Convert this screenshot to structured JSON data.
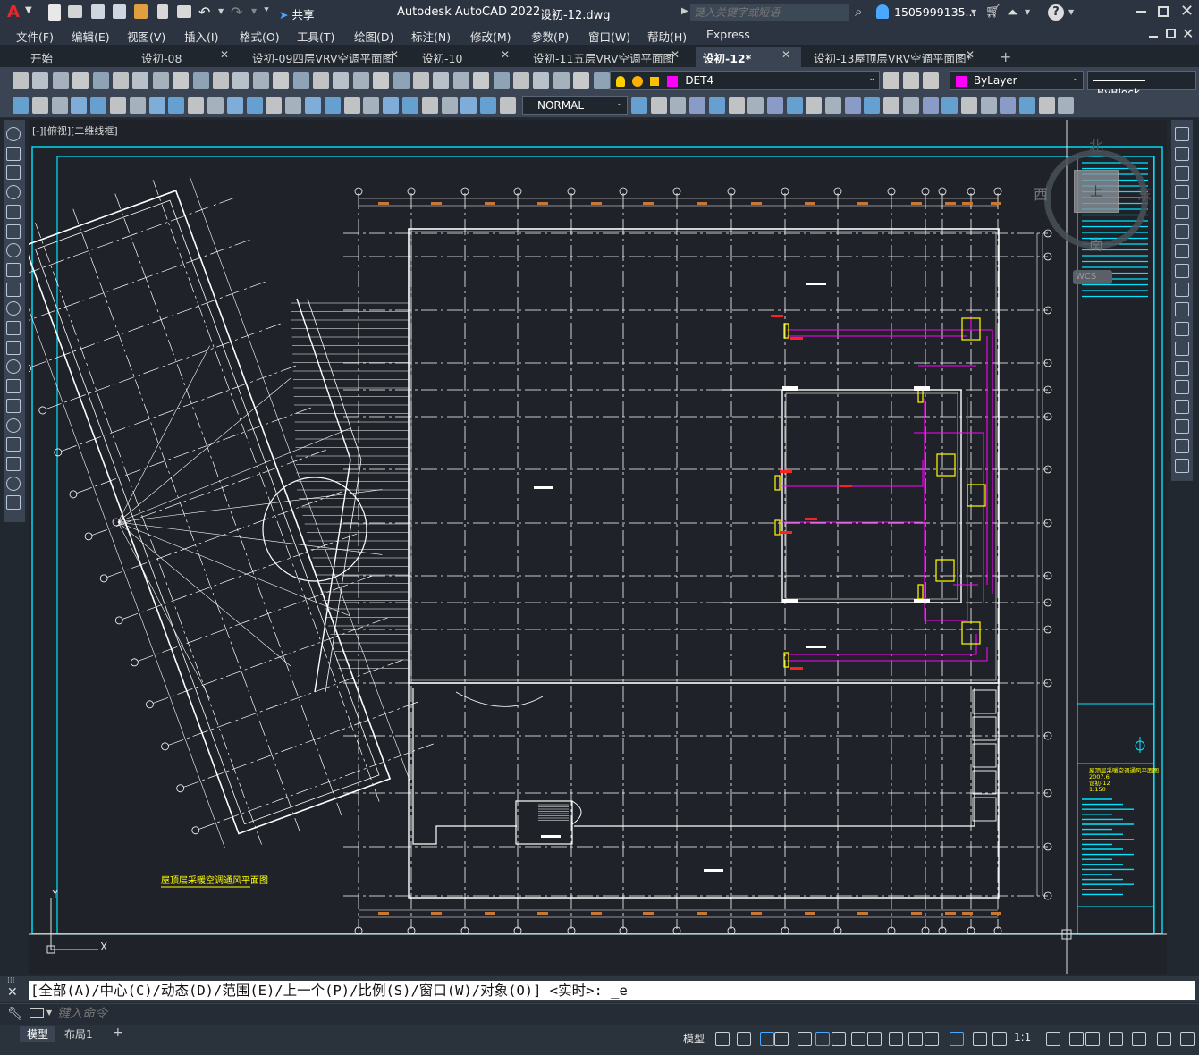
{
  "app": {
    "logo": "A",
    "title": "Autodesk AutoCAD 2022",
    "filename": "设初-12.dwg",
    "share_label": "共享",
    "search_placeholder": "键入关键字或短语",
    "user": "1505999135...",
    "help": "?"
  },
  "menu": [
    "文件(F)",
    "编辑(E)",
    "视图(V)",
    "插入(I)",
    "格式(O)",
    "工具(T)",
    "绘图(D)",
    "标注(N)",
    "修改(M)",
    "参数(P)",
    "窗口(W)",
    "帮助(H)",
    "Express"
  ],
  "tabs": [
    {
      "label": "开始",
      "active": false,
      "close": false
    },
    {
      "label": "设初-08",
      "active": false,
      "close": true
    },
    {
      "label": "设初-09四层VRV空调平面图",
      "active": false,
      "close": true
    },
    {
      "label": "设初-10",
      "active": false,
      "close": true
    },
    {
      "label": "设初-11五层VRV空调平面图",
      "active": false,
      "close": true
    },
    {
      "label": "设初-12*",
      "active": true,
      "close": true
    },
    {
      "label": "设初-13屋顶层VRV空调平面图*",
      "active": false,
      "close": true
    }
  ],
  "add_tab": "+",
  "toolbar": {
    "layer_name": "DET4",
    "color_name": "ByLayer",
    "linetype_name": "ByBlock",
    "dimstyle": "NORMAL",
    "layer_color": "#ff00ff"
  },
  "viewport": {
    "label": "[-][俯视][二维线框]",
    "drawing_title": "屋顶层采暖空调通风平面图",
    "viewcube": {
      "north": "北",
      "south": "南",
      "east": "东",
      "west": "西",
      "top": "上",
      "wcs": "WCS"
    },
    "ucs_y": "Y",
    "ucs_x": "X",
    "title_block_lines": [
      "屋顶层采暖空调通风平面图",
      "2007.6",
      "设初-12",
      "1:150"
    ]
  },
  "command": {
    "history": "[全部(A)/中心(C)/动态(D)/范围(E)/上一个(P)/比例(S)/窗口(W)/对象(O)] <实时>: _e",
    "placeholder": "键入命令"
  },
  "status": {
    "tabs": [
      "模型",
      "布局1"
    ],
    "add": "+",
    "model_label": "模型",
    "scale": "1:1"
  },
  "colors": {
    "background": "#1f2228",
    "frame_cyan": "#00e5ff",
    "line_white": "#ffffff",
    "duct_magenta": "#ff00ff",
    "unit_yellow": "#ffff00",
    "label_red": "#ff2020",
    "dim_orange": "#c87832"
  }
}
